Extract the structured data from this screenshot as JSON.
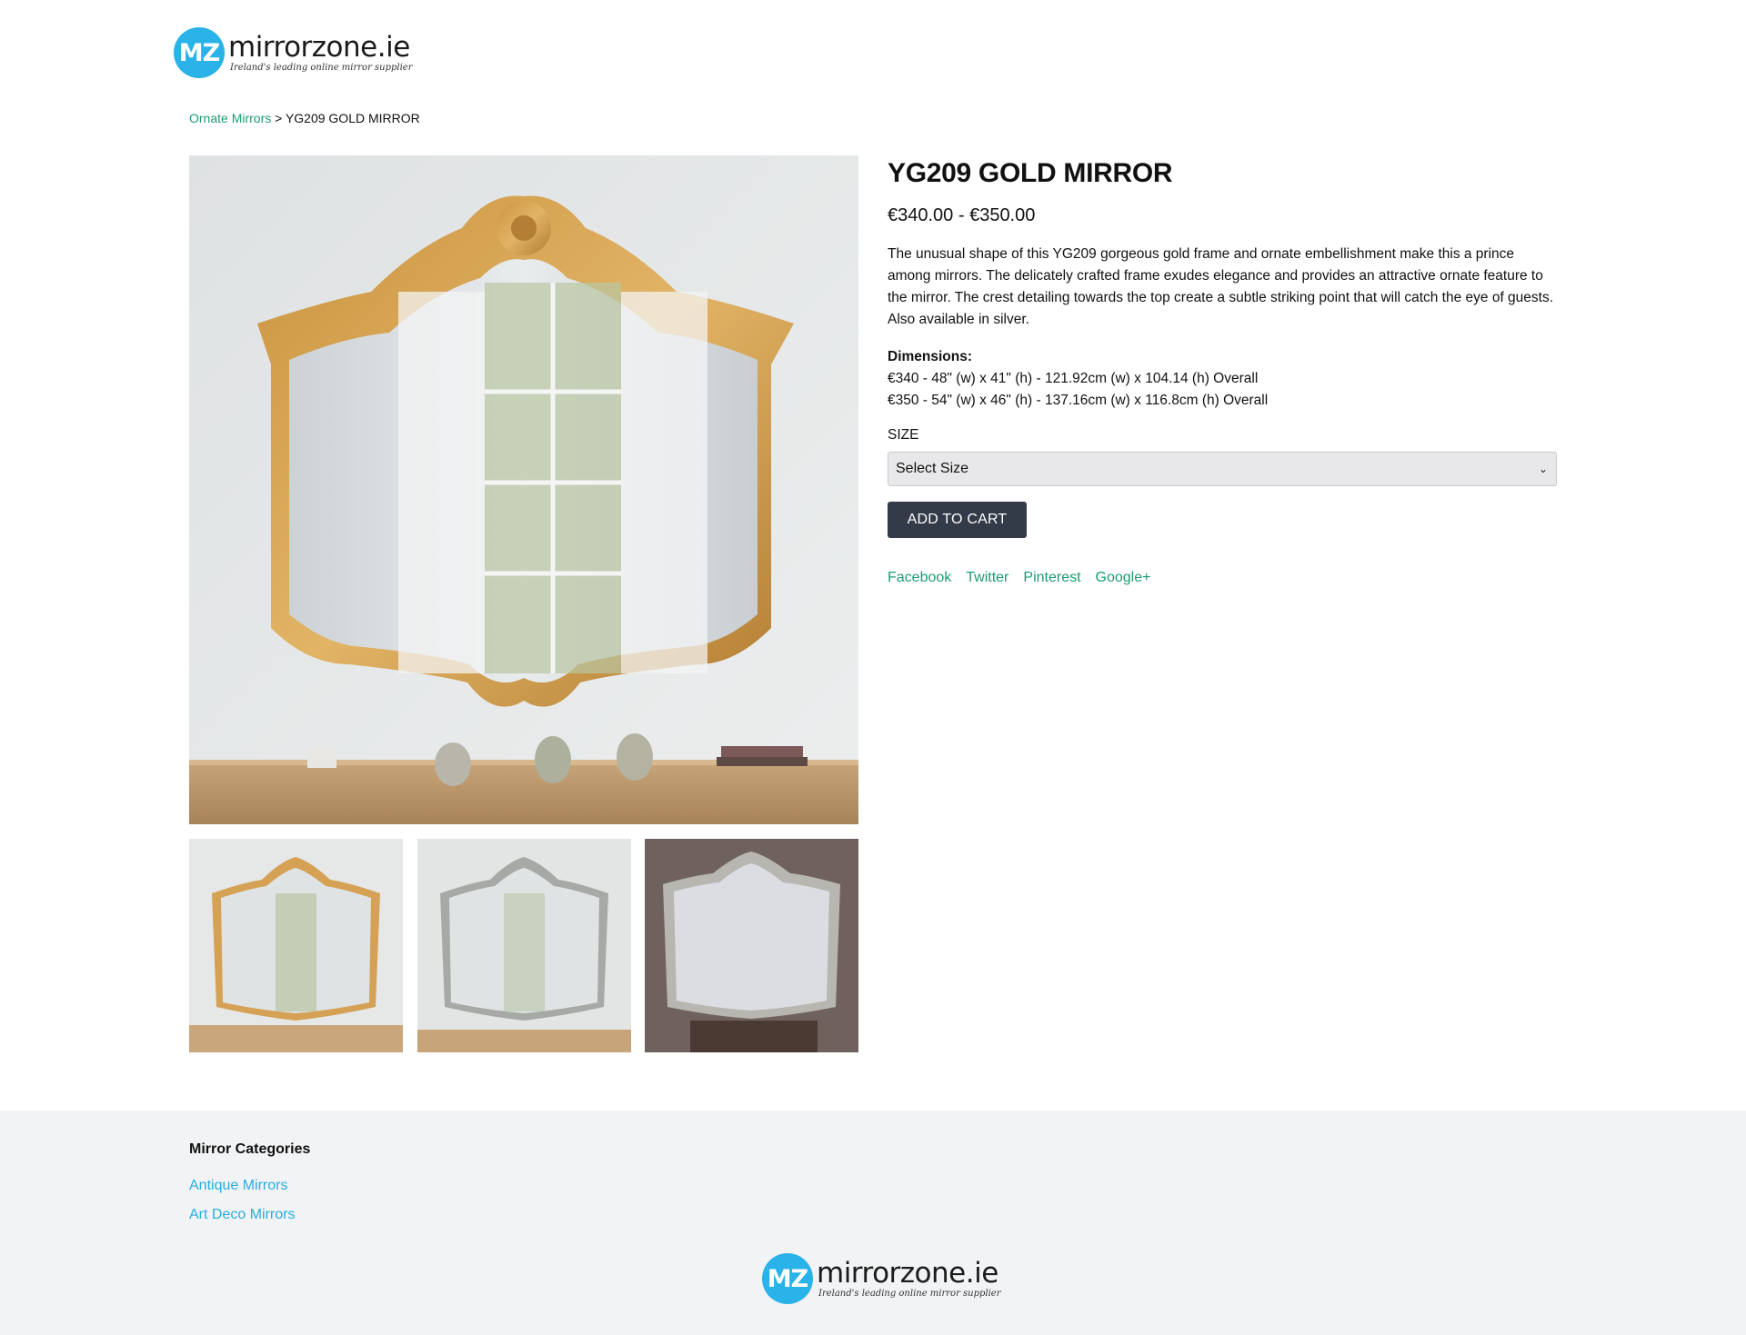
{
  "header": {
    "logo_badge": "MZ",
    "logo_name": "mirrorzone.ie",
    "logo_tagline": "Ireland's leading online mirror supplier"
  },
  "breadcrumb": {
    "parent": "Ornate Mirrors",
    "separator": " > ",
    "current": "YG209 GOLD MIRROR"
  },
  "product": {
    "title": "YG209 GOLD MIRROR",
    "price": "€340.00 - €350.00",
    "description": "The unusual shape of this YG209 gorgeous gold frame and ornate embellishment make this a prince among mirrors. The delicately crafted frame exudes elegance and provides an attractive ornate feature to the mirror. The crest detailing towards the top create a subtle striking point that will catch the eye of guests. Also available in silver.",
    "dimensions_label": "Dimensions:",
    "dimensions": [
      "€340 - 48\" (w) x 41\" (h) - 121.92cm (w) x 104.14 (h) Overall",
      "€350 - 54\" (w) x 46\" (h) - 137.16cm (w) x 116.8cm (h) Overall"
    ],
    "size_label": "SIZE",
    "size_select_value": "Select Size",
    "add_to_cart": "ADD TO CART"
  },
  "share": [
    "Facebook",
    "Twitter",
    "Pinterest",
    "Google+"
  ],
  "gallery": {
    "main_image": "gold-ornate-mirror-photo",
    "thumbnails": [
      "gold-mirror-thumbnail",
      "silver-mirror-window-thumbnail",
      "silver-mirror-dark-wall-thumbnail"
    ]
  },
  "footer": {
    "categories_heading": "Mirror Categories",
    "categories": [
      "Antique Mirrors",
      "Art Deco Mirrors"
    ],
    "logo_badge": "MZ",
    "logo_name": "mirrorzone.ie",
    "logo_tagline": "Ireland's leading online mirror supplier"
  },
  "colors": {
    "accent_green": "#1c9c74",
    "footer_link_blue": "#27aee0",
    "button_dark": "#333a48",
    "logo_blue": "#29b3e8",
    "footer_bg": "#f2f3f5"
  }
}
